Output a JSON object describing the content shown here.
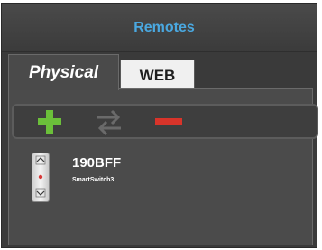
{
  "window": {
    "title": "Remotes"
  },
  "tabs": [
    {
      "label": "Physical",
      "selected": true
    },
    {
      "label": "WEB",
      "selected": false
    }
  ],
  "toolbar": {
    "buttons": [
      {
        "name": "add",
        "icon": "plus-icon",
        "color": "#6bbf3a"
      },
      {
        "name": "swap",
        "icon": "swap-arrows-icon",
        "color": "#6a6a6a"
      },
      {
        "name": "remove",
        "icon": "minus-icon",
        "color": "#d8342a"
      }
    ]
  },
  "remotes": [
    {
      "name": "190BFF",
      "model": "SmartSwitch3",
      "icon": "remote-switch-icon"
    }
  ],
  "colors": {
    "title": "#4aa8e0",
    "panel_bg": "#3a3a3a",
    "content_bg": "#4b4b4b"
  }
}
